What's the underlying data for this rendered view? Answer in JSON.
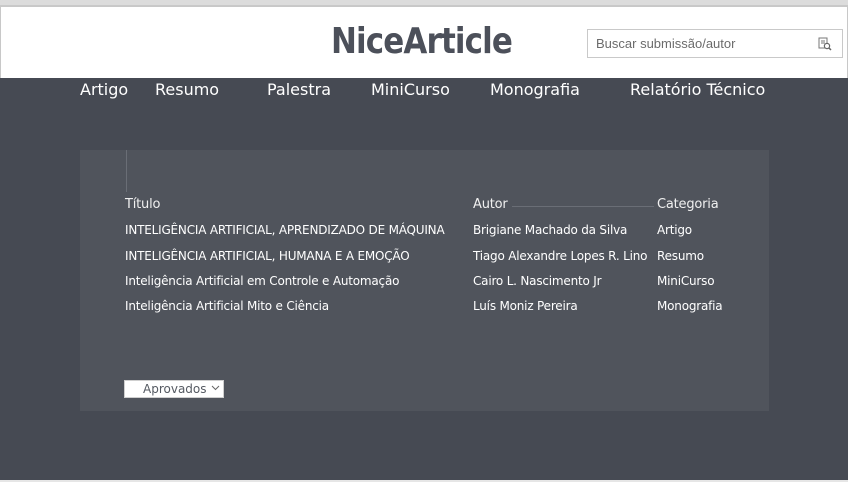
{
  "header": {
    "brand": "NiceArticle",
    "search": {
      "placeholder": "Buscar submissão/autor",
      "value": ""
    },
    "search_icon": "search-document-icon"
  },
  "nav": {
    "items": [
      {
        "label": "Artigo"
      },
      {
        "label": "Resumo"
      },
      {
        "label": "Palestra"
      },
      {
        "label": "MiniCurso"
      },
      {
        "label": "Monografia"
      },
      {
        "label": "Relatório Técnico"
      }
    ]
  },
  "table": {
    "columns": [
      "Título",
      "Autor",
      "Categoria"
    ],
    "rows": [
      [
        "INTELIGÊNCIA ARTIFICIAL, APRENDIZADO DE MÁQUINA",
        "Brigiane Machado da Silva",
        "Artigo"
      ],
      [
        "INTELIGÊNCIA ARTIFICIAL, HUMANA E A EMOÇÃO",
        "Tiago Alexandre Lopes R. Lino",
        "Resumo"
      ],
      [
        "Inteligência Artificial em Controle e Automação",
        "Cairo L. Nascimento Jr",
        "MiniCurso"
      ],
      [
        "Inteligência Artificial Mito e Ciência",
        "Luís Moniz Pereira",
        "Monografia"
      ]
    ]
  },
  "filter": {
    "selected": "Aprovados"
  },
  "colors": {
    "background": "#464a53",
    "panel": "#50545c",
    "brand_text": "#4c505a"
  }
}
